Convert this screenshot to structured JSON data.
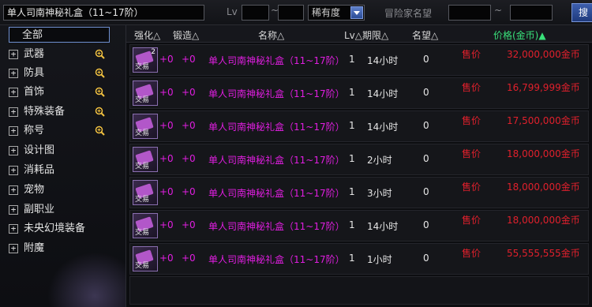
{
  "top": {
    "search_value": "单人司南神秘礼盒（11~17阶）",
    "lv_label": "Lv",
    "tilde": "~",
    "rarity_select": "稀有度",
    "adventurer_label": "冒险家名望",
    "search_button": "搜"
  },
  "sidebar": {
    "items": [
      {
        "label": "全部",
        "selected": true
      },
      {
        "label": "武器",
        "zoom": true
      },
      {
        "label": "防具",
        "zoom": true
      },
      {
        "label": "首饰",
        "zoom": true
      },
      {
        "label": "特殊装备",
        "zoom": true
      },
      {
        "label": "称号",
        "zoom": true
      },
      {
        "label": "设计图"
      },
      {
        "label": "消耗品"
      },
      {
        "label": "宠物"
      },
      {
        "label": "副职业"
      },
      {
        "label": "未央幻境装备"
      },
      {
        "label": "附魔"
      }
    ],
    "plus_symbol": "+"
  },
  "header": {
    "enhance": "强化△",
    "forge": "锻造△",
    "name": "名称△",
    "lv_period": "Lv△期限△",
    "fame": "名望△",
    "price": "价格(金币)▲"
  },
  "rows": [
    {
      "qty": "2",
      "trade": "交易",
      "enhance": "+0",
      "forge": "+0",
      "name": "单人司南神秘礼盒（11~17阶）",
      "lv": "1",
      "period": "14小时",
      "fame": "0",
      "sale": "售价",
      "price": "32,000,000金币"
    },
    {
      "qty": "",
      "trade": "交易",
      "enhance": "+0",
      "forge": "+0",
      "name": "单人司南神秘礼盒（11~17阶）",
      "lv": "1",
      "period": "14小时",
      "fame": "0",
      "sale": "售价",
      "price": "16,799,999金币"
    },
    {
      "qty": "",
      "trade": "交易",
      "enhance": "+0",
      "forge": "+0",
      "name": "单人司南神秘礼盒（11~17阶）",
      "lv": "1",
      "period": "14小时",
      "fame": "0",
      "sale": "售价",
      "price": "17,500,000金币"
    },
    {
      "qty": "",
      "trade": "交易",
      "enhance": "+0",
      "forge": "+0",
      "name": "单人司南神秘礼盒（11~17阶）",
      "lv": "1",
      "period": "2小时",
      "fame": "0",
      "sale": "售价",
      "price": "18,000,000金币"
    },
    {
      "qty": "",
      "trade": "交易",
      "enhance": "+0",
      "forge": "+0",
      "name": "单人司南神秘礼盒（11~17阶）",
      "lv": "1",
      "period": "3小时",
      "fame": "0",
      "sale": "售价",
      "price": "18,000,000金币"
    },
    {
      "qty": "",
      "trade": "交易",
      "enhance": "+0",
      "forge": "+0",
      "name": "单人司南神秘礼盒（11~17阶）",
      "lv": "1",
      "period": "14小时",
      "fame": "0",
      "sale": "售价",
      "price": "18,000,000金币"
    },
    {
      "qty": "",
      "trade": "交易",
      "enhance": "+0",
      "forge": "+0",
      "name": "单人司南神秘礼盒（11~17阶）",
      "lv": "1",
      "period": "1小时",
      "fame": "0",
      "sale": "售价",
      "price": "55,555,555金币"
    }
  ],
  "colors": {
    "enhance_magenta": "#e01ee0",
    "price_red": "#e0202c",
    "price_header_green": "#39e07a",
    "selection_blue": "#6f8fcf"
  },
  "icons": [
    "plus-box-icon",
    "zoom-icon",
    "dropdown-arrow-icon",
    "item-box-icon"
  ]
}
